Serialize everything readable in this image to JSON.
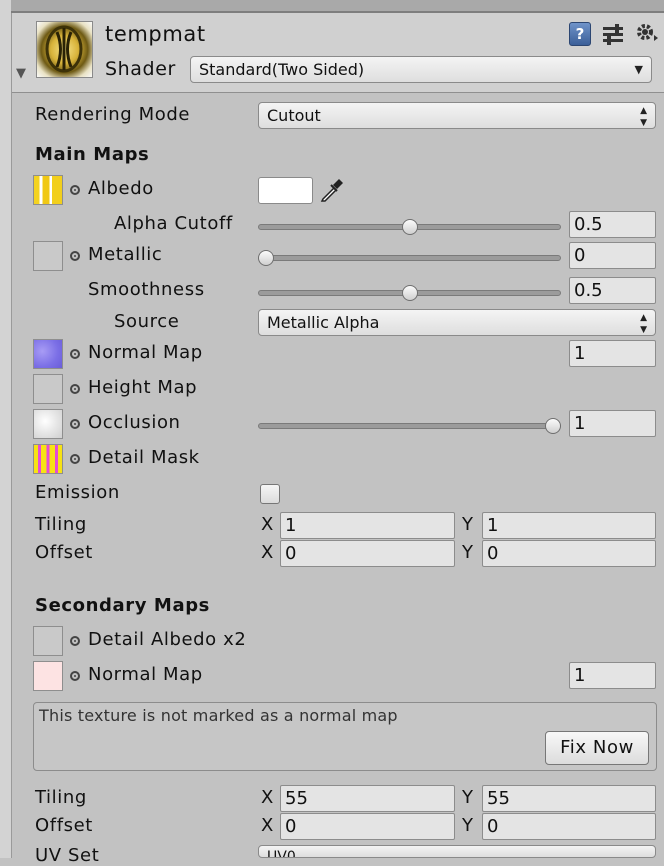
{
  "material": {
    "name": "tempmat",
    "shader_label": "Shader",
    "shader_value": "Standard(Two Sided)",
    "header_icons": [
      "help-book-icon",
      "preset-sliders-icon",
      "gear-icon"
    ]
  },
  "rendering": {
    "label": "Rendering Mode",
    "value": "Cutout"
  },
  "main_maps": {
    "title": "Main Maps",
    "albedo": {
      "label": "Albedo",
      "color": "#ffffff"
    },
    "alpha_cutoff": {
      "label": "Alpha Cutoff",
      "value": "0.5",
      "fraction": 0.5
    },
    "metallic": {
      "label": "Metallic",
      "value": "0",
      "fraction": 0.0
    },
    "smoothness": {
      "label": "Smoothness",
      "value": "0.5",
      "fraction": 0.5
    },
    "source": {
      "label": "Source",
      "value": "Metallic Alpha"
    },
    "normal_map": {
      "label": "Normal Map",
      "value": "1"
    },
    "height_map": {
      "label": "Height Map"
    },
    "occlusion": {
      "label": "Occlusion",
      "value": "1",
      "fraction": 1.0
    },
    "detail_mask": {
      "label": "Detail Mask"
    },
    "emission": {
      "label": "Emission"
    },
    "tiling": {
      "label": "Tiling",
      "x_label": "X",
      "x": "1",
      "y_label": "Y",
      "y": "1"
    },
    "offset": {
      "label": "Offset",
      "x_label": "X",
      "x": "0",
      "y_label": "Y",
      "y": "0"
    }
  },
  "secondary_maps": {
    "title": "Secondary Maps",
    "detail_albedo": {
      "label": "Detail Albedo x2"
    },
    "normal_map": {
      "label": "Normal Map",
      "value": "1"
    },
    "warning": {
      "text": "This texture is not marked as a normal map",
      "button": "Fix Now"
    },
    "tiling": {
      "label": "Tiling",
      "x_label": "X",
      "x": "55",
      "y_label": "Y",
      "y": "55"
    },
    "offset": {
      "label": "Offset",
      "x_label": "X",
      "x": "0",
      "y_label": "Y",
      "y": "0"
    },
    "uv_set": {
      "label": "UV Set",
      "value": "UV0"
    }
  }
}
